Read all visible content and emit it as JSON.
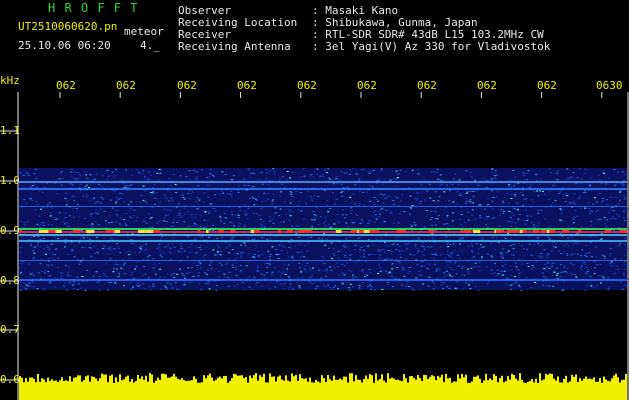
{
  "header": {
    "brand": "H R O F F T",
    "filename": "UT2510060620.pn",
    "mode": "meteor",
    "datetime": "25.10.06 06:20",
    "extra": "4._",
    "fields": [
      {
        "label": "Observer",
        "value": ": Masaki Kano"
      },
      {
        "label": "Receiving Location",
        "value": ": Shibukawa, Gunma, Japan"
      },
      {
        "label": "Receiver",
        "value": ": RTL-SDR SDR# 43dB L15 103.2MHz CW"
      },
      {
        "label": "Receiving Antenna",
        "value": ": 3el Yagi(V) Az 330 for Vladivostok"
      }
    ]
  },
  "axes": {
    "y_unit": "kHz",
    "y_ticks": [
      "1.1",
      "1.0",
      "0.9",
      "0.8",
      "0.7",
      "0.6"
    ],
    "x_ticks": [
      "062",
      "062",
      "062",
      "062",
      "062",
      "062",
      "062",
      "062",
      "062",
      "0630"
    ]
  },
  "colors": {
    "background": "#000000",
    "text_yellow": "#f0f000",
    "text_white": "#e8e8e8",
    "brand_green": "#22dd22",
    "signal_red": "#ff3030",
    "signal_green": "#30ff60",
    "noise_blue": "#2040e0",
    "level_yellow": "#f0f000"
  }
}
